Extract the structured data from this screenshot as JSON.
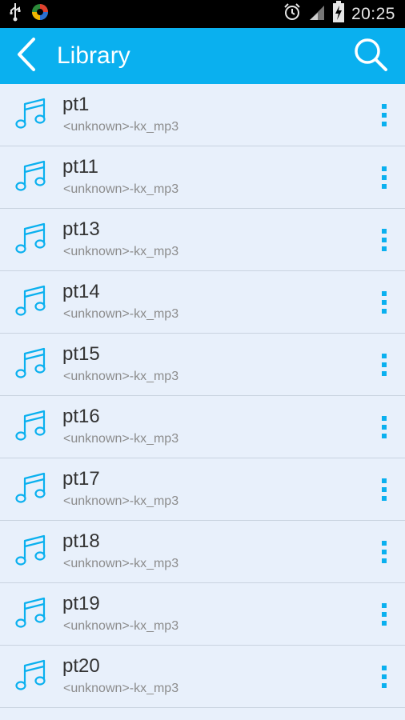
{
  "status_bar": {
    "time": "20:25",
    "icons": [
      "usb-icon",
      "app-notification-icon",
      "alarm-icon",
      "signal-icon",
      "battery-charging-icon"
    ]
  },
  "app_bar": {
    "title": "Library",
    "back_icon": "chevron-left-icon",
    "search_icon": "search-icon",
    "background": "#0ab0ef"
  },
  "tracks": [
    {
      "title": "pt1",
      "subtitle": "<unknown>-kx_mp3"
    },
    {
      "title": "pt11",
      "subtitle": "<unknown>-kx_mp3"
    },
    {
      "title": "pt13",
      "subtitle": "<unknown>-kx_mp3"
    },
    {
      "title": "pt14",
      "subtitle": "<unknown>-kx_mp3"
    },
    {
      "title": "pt15",
      "subtitle": "<unknown>-kx_mp3"
    },
    {
      "title": "pt16",
      "subtitle": "<unknown>-kx_mp3"
    },
    {
      "title": "pt17",
      "subtitle": "<unknown>-kx_mp3"
    },
    {
      "title": "pt18",
      "subtitle": "<unknown>-kx_mp3"
    },
    {
      "title": "pt19",
      "subtitle": "<unknown>-kx_mp3"
    },
    {
      "title": "pt20",
      "subtitle": "<unknown>-kx_mp3"
    }
  ],
  "colors": {
    "accent": "#0ab0ef",
    "list_background": "#e8f0fb"
  }
}
